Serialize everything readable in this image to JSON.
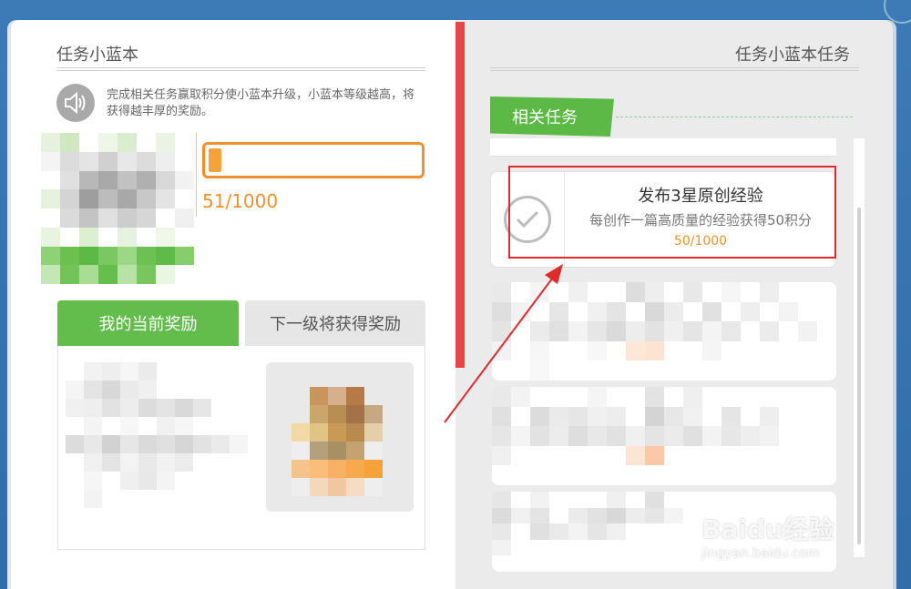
{
  "left_page": {
    "title": "任务小蓝本",
    "intro": "完成相关任务赢取积分使小蓝本升级，小蓝本等级越高，将获得越丰厚的奖励。",
    "progress": {
      "value": 51,
      "max": 1000,
      "text": "51/1000"
    },
    "tabs": [
      {
        "label": "我的当前奖励",
        "active": true
      },
      {
        "label": "下一级将获得奖励",
        "active": false
      }
    ]
  },
  "right_page": {
    "title": "任务小蓝本任务",
    "section_label": "相关任务",
    "tasks": [
      {
        "name": "发布3星原创经验",
        "description": "每创作一篇高质量的经验获得50积分",
        "progress": "50/1000",
        "completed_icon": "check-circle-icon"
      }
    ]
  },
  "watermark": {
    "brand": "Baidu经验",
    "url": "jingyan.baidu.com"
  },
  "colors": {
    "accent_green": "#62bd4c",
    "accent_orange": "#f0912e",
    "spine_red": "#e84545",
    "annotation_red": "#e02b2b",
    "background_blue": "#2f6ea8"
  }
}
